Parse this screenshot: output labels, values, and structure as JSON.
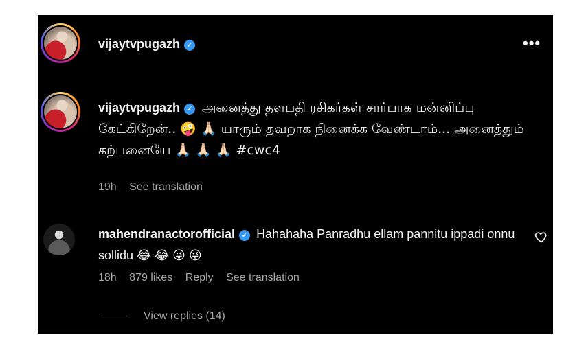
{
  "header": {
    "username": "vijaytvpugazh",
    "more_label": "•••"
  },
  "caption": {
    "username": "vijaytvpugazh",
    "text": "அனைத்து தளபதி ரசிகர்கள் சார்பாக மன்னிப்பு கேட்கிறேன்.. 🤪 🙏🏻 யாரும் தவறாக நினைக்க வேண்டாம்... அனைத்தும் கற்பனையே 🙏🏻 🙏🏻 🙏🏻 #cwc4",
    "time": "19h",
    "see_translation": "See translation"
  },
  "comment": {
    "username": "mahendranactorofficial",
    "text": "Hahahaha Panradhu ellam pannitu ippadi onnu sollidu 😂 😂 😜 😜",
    "time": "18h",
    "likes": "879 likes",
    "reply": "Reply",
    "see_translation": "See translation"
  },
  "replies": {
    "label": "View replies (14)"
  },
  "icons": {
    "verified": "verified-badge-icon",
    "more": "more-options-icon",
    "like": "heart-icon"
  },
  "colors": {
    "background": "#000000",
    "text": "#f5f5f5",
    "muted": "#a8a8a8",
    "verified": "#3897f0"
  }
}
